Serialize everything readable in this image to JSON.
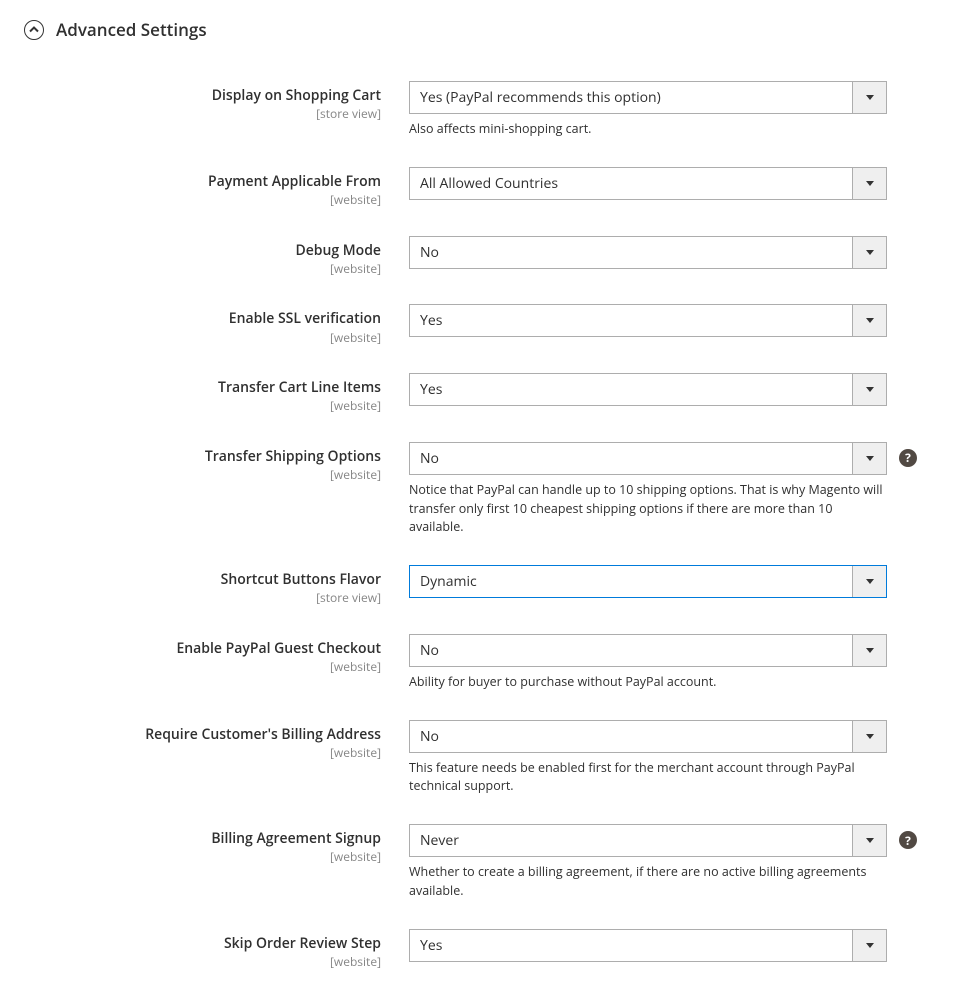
{
  "section": {
    "title": "Advanced Settings"
  },
  "scopes": {
    "store_view": "[store view]",
    "website": "[website]"
  },
  "help_glyph": "?",
  "fields": {
    "display_on_cart": {
      "label": "Display on Shopping Cart",
      "value": "Yes (PayPal recommends this option)",
      "note": "Also affects mini-shopping cart."
    },
    "payment_applicable_from": {
      "label": "Payment Applicable From",
      "value": "All Allowed Countries"
    },
    "debug_mode": {
      "label": "Debug Mode",
      "value": "No"
    },
    "enable_ssl_verification": {
      "label": "Enable SSL verification",
      "value": "Yes"
    },
    "transfer_cart_line_items": {
      "label": "Transfer Cart Line Items",
      "value": "Yes"
    },
    "transfer_shipping_options": {
      "label": "Transfer Shipping Options",
      "value": "No",
      "note": "Notice that PayPal can handle up to 10 shipping options. That is why Magento will transfer only first 10 cheapest shipping options if there are more than 10 available."
    },
    "shortcut_buttons_flavor": {
      "label": "Shortcut Buttons Flavor",
      "value": "Dynamic"
    },
    "enable_guest_checkout": {
      "label": "Enable PayPal Guest Checkout",
      "value": "No",
      "note": "Ability for buyer to purchase without PayPal account."
    },
    "require_billing_address": {
      "label": "Require Customer's Billing Address",
      "value": "No",
      "note": "This feature needs be enabled first for the merchant account through PayPal technical support."
    },
    "billing_agreement_signup": {
      "label": "Billing Agreement Signup",
      "value": "Never",
      "note": "Whether to create a billing agreement, if there are no active billing agreements available."
    },
    "skip_order_review_step": {
      "label": "Skip Order Review Step",
      "value": "Yes"
    }
  }
}
